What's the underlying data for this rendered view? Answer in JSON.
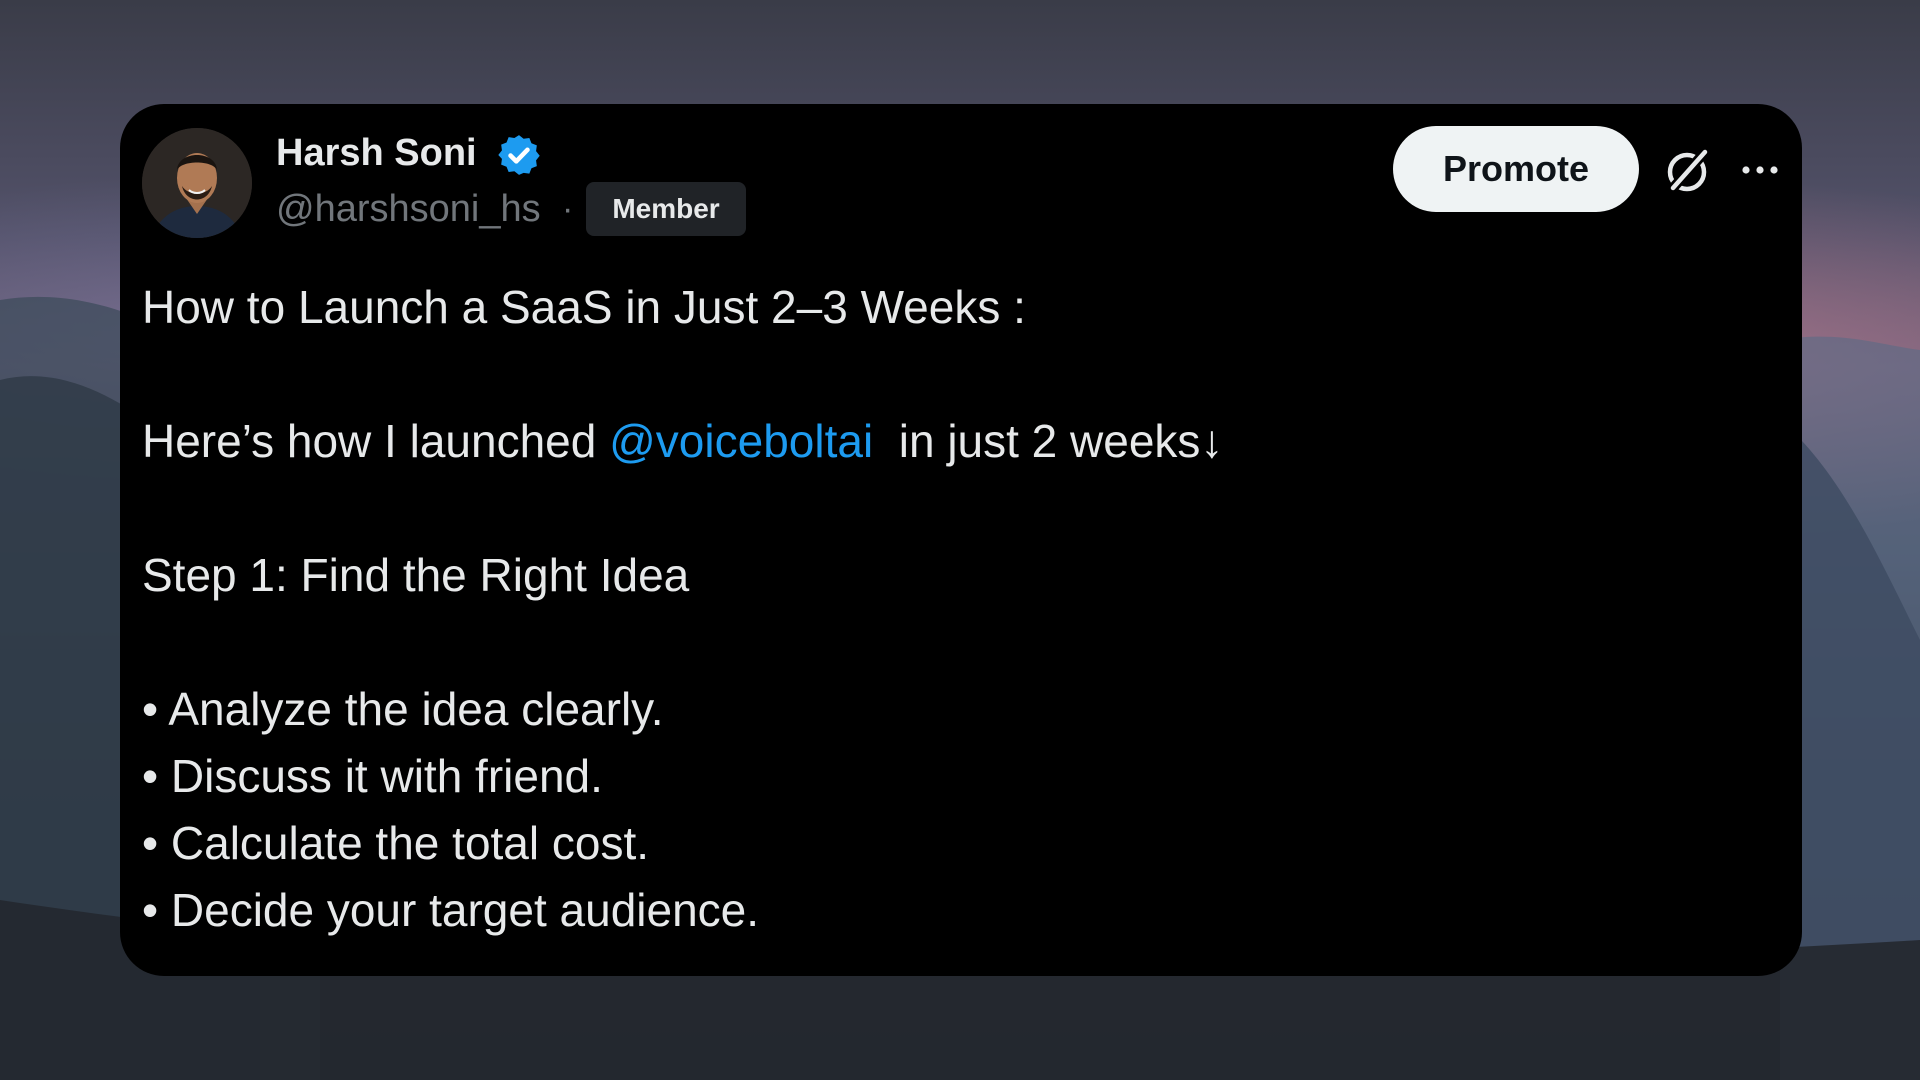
{
  "post": {
    "author": {
      "name": "Harsh Soni",
      "handle": "@harshsoni_hs",
      "separator": "·",
      "badge": "Member",
      "verified_icon": "verified-badge-icon",
      "verified_color": "#1d9bf0"
    },
    "actions": {
      "promote_label": "Promote",
      "grok_icon": "grok-icon",
      "more_icon": "more-icon"
    },
    "body": {
      "title": "How to Launch a SaaS in Just 2–3 Weeks :",
      "intro_before": "Here’s how I launched ",
      "intro_mention": "@voiceboltai",
      "intro_after": "  in just 2 weeks↓",
      "step_heading": "Step 1: Find the Right Idea",
      "bullets": [
        "• Analyze the idea clearly.",
        "• Discuss it with friend.",
        "• Calculate the total cost.",
        "• Decide your target audience."
      ]
    }
  },
  "colors": {
    "card_background": "#000000",
    "text_primary": "#e7e9ea",
    "text_secondary": "#71767b",
    "link": "#1d9bf0",
    "button_background": "#eff3f4"
  }
}
